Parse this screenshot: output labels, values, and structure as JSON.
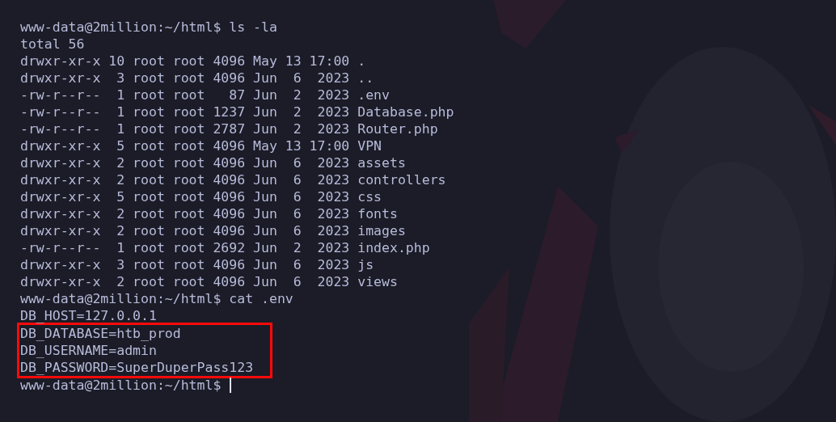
{
  "terminal": {
    "cursor_visible": true,
    "lines": [
      {
        "text": "www-data@2million:~/html$ ls -la",
        "highlighted": false
      },
      {
        "text": "total 56",
        "highlighted": false
      },
      {
        "text": "drwxr-xr-x 10 root root 4096 May 13 17:00 .",
        "highlighted": false
      },
      {
        "text": "drwxr-xr-x  3 root root 4096 Jun  6  2023 ..",
        "highlighted": false
      },
      {
        "text": "-rw-r--r--  1 root root   87 Jun  2  2023 .env",
        "highlighted": false
      },
      {
        "text": "-rw-r--r--  1 root root 1237 Jun  2  2023 Database.php",
        "highlighted": false
      },
      {
        "text": "-rw-r--r--  1 root root 2787 Jun  2  2023 Router.php",
        "highlighted": false
      },
      {
        "text": "drwxr-xr-x  5 root root 4096 May 13 17:00 VPN",
        "highlighted": false
      },
      {
        "text": "drwxr-xr-x  2 root root 4096 Jun  6  2023 assets",
        "highlighted": false
      },
      {
        "text": "drwxr-xr-x  2 root root 4096 Jun  6  2023 controllers",
        "highlighted": false
      },
      {
        "text": "drwxr-xr-x  5 root root 4096 Jun  6  2023 css",
        "highlighted": false
      },
      {
        "text": "drwxr-xr-x  2 root root 4096 Jun  6  2023 fonts",
        "highlighted": false
      },
      {
        "text": "drwxr-xr-x  2 root root 4096 Jun  6  2023 images",
        "highlighted": false
      },
      {
        "text": "-rw-r--r--  1 root root 2692 Jun  2  2023 index.php",
        "highlighted": false
      },
      {
        "text": "drwxr-xr-x  3 root root 4096 Jun  6  2023 js",
        "highlighted": false
      },
      {
        "text": "drwxr-xr-x  2 root root 4096 Jun  6  2023 views",
        "highlighted": false
      },
      {
        "text": "www-data@2million:~/html$ cat .env",
        "highlighted": false
      },
      {
        "text": "DB_HOST=127.0.0.1",
        "highlighted": false
      },
      {
        "text": "DB_DATABASE=htb_prod",
        "highlighted": true
      },
      {
        "text": "DB_USERNAME=admin",
        "highlighted": true
      },
      {
        "text": "DB_PASSWORD=SuperDuperPass123",
        "highlighted": true
      },
      {
        "text": "www-data@2million:~/html$ ",
        "highlighted": false
      }
    ]
  }
}
